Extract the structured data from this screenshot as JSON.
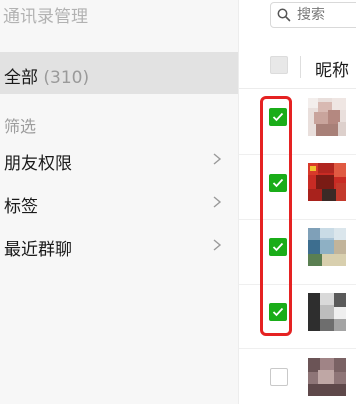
{
  "sidebar": {
    "title": "通讯录管理",
    "all_label": "全部",
    "all_count": "(310)",
    "filter_section": "筛选",
    "items": [
      {
        "label": "朋友权限"
      },
      {
        "label": "标签"
      },
      {
        "label": "最近群聊"
      }
    ]
  },
  "search": {
    "placeholder": "搜索"
  },
  "table": {
    "header": {
      "nickname": "昵称"
    },
    "rows": [
      {
        "checked": true
      },
      {
        "checked": true
      },
      {
        "checked": true
      },
      {
        "checked": true
      },
      {
        "checked": false
      }
    ]
  },
  "colors": {
    "check_green": "#1aad19",
    "highlight_red": "#e52222",
    "sidebar_bg": "#f7f7f7",
    "selected_bg": "#e2e2e2"
  }
}
